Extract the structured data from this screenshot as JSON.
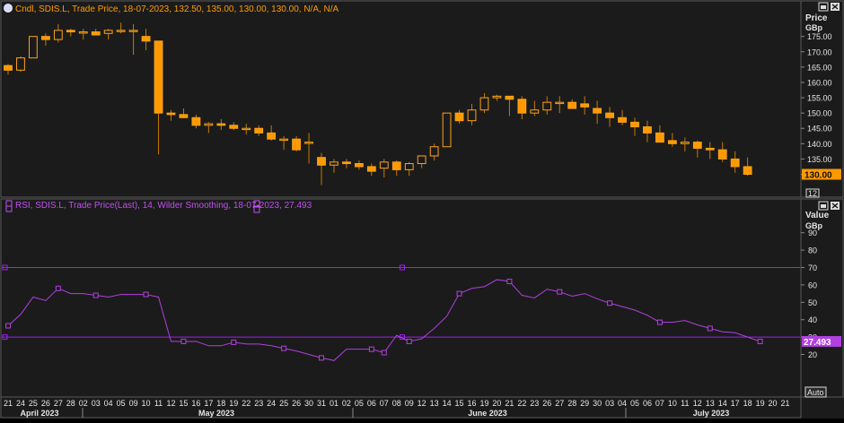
{
  "colors": {
    "background": "#1b1b1b",
    "panel_border": "#5a5a5a",
    "candle_fill": "#ff9900",
    "candle_outline": "#ffa31a",
    "wick": "#c97a00",
    "rsi_line": "#b040e0",
    "level_line": "#a020f0",
    "text": "#e6e6e6",
    "legend_price": "#ff9d00",
    "legend_rsi": "#c050f0",
    "price_tag_bg": "#ff9900",
    "rsi_tag_bg": "#b040e0"
  },
  "icons": {
    "restore": "restore-window-icon",
    "close": "close-icon",
    "legend": "legend-marker-icon"
  },
  "price_panel": {
    "legend": "Cndl, SDIS.L, Trade Price, 18-07-2023, 132.50, 135.00, 130.00, 130.00, N/A, N/A",
    "axis_title": "Price",
    "axis_unit": "GBp",
    "last_price_label": "130.00",
    "interval_badge": "12"
  },
  "rsi_panel": {
    "legend": "RSI, SDIS.L, Trade Price(Last), 14, Wilder Smoothing, 18-07-2023, 27.493",
    "axis_title": "Value",
    "axis_unit": "GBp",
    "last_value_label": "27.493",
    "auto_button": "Auto"
  },
  "chart_data": [
    {
      "type": "candlestick",
      "title": "",
      "ylabel": "Price",
      "yunit": "GBp",
      "ylim": [
        125,
        180
      ],
      "yticks": [
        130,
        135,
        140,
        145,
        150,
        155,
        160,
        165,
        170,
        175
      ],
      "x": [
        "2023-04-21",
        "2023-04-24",
        "2023-04-25",
        "2023-04-26",
        "2023-04-27",
        "2023-04-28",
        "2023-05-02",
        "2023-05-03",
        "2023-05-04",
        "2023-05-05",
        "2023-05-09",
        "2023-05-10",
        "2023-05-11",
        "2023-05-12",
        "2023-05-15",
        "2023-05-16",
        "2023-05-17",
        "2023-05-18",
        "2023-05-19",
        "2023-05-22",
        "2023-05-23",
        "2023-05-24",
        "2023-05-25",
        "2023-05-26",
        "2023-05-30",
        "2023-05-31",
        "2023-06-01",
        "2023-06-02",
        "2023-06-05",
        "2023-06-06",
        "2023-06-07",
        "2023-06-08",
        "2023-06-09",
        "2023-06-12",
        "2023-06-13",
        "2023-06-14",
        "2023-06-15",
        "2023-06-16",
        "2023-06-19",
        "2023-06-20",
        "2023-06-21",
        "2023-06-22",
        "2023-06-23",
        "2023-06-26",
        "2023-06-27",
        "2023-06-28",
        "2023-06-29",
        "2023-06-30",
        "2023-07-03",
        "2023-07-04",
        "2023-07-05",
        "2023-07-06",
        "2023-07-07",
        "2023-07-10",
        "2023-07-11",
        "2023-07-12",
        "2023-07-13",
        "2023-07-14",
        "2023-07-17",
        "2023-07-18"
      ],
      "open": [
        165.5,
        164.0,
        168.0,
        175.0,
        174.0,
        177.0,
        176.5,
        176.5,
        176.0,
        177.0,
        177.0,
        175.0,
        173.5,
        150.0,
        149.5,
        148.5,
        146.0,
        146.5,
        146.0,
        145.0,
        145.0,
        143.5,
        141.5,
        141.5,
        140.5,
        135.5,
        133.0,
        134.0,
        133.5,
        132.5,
        132.0,
        134.0,
        131.5,
        133.5,
        136.0,
        139.0,
        150.0,
        147.5,
        151.0,
        155.0,
        155.5,
        154.5,
        150.0,
        151.0,
        153.5,
        153.5,
        153.0,
        151.5,
        150.0,
        148.5,
        147.0,
        145.5,
        143.5,
        141.0,
        140.0,
        140.5,
        138.5,
        138.0,
        135.0,
        132.5
      ],
      "high": [
        166.0,
        168.5,
        175.0,
        176.0,
        179.0,
        177.5,
        177.5,
        177.5,
        177.5,
        179.5,
        179.0,
        177.5,
        173.5,
        151.0,
        151.5,
        149.5,
        147.0,
        148.0,
        147.0,
        146.5,
        146.0,
        146.0,
        142.5,
        142.5,
        143.5,
        137.0,
        135.0,
        135.0,
        134.5,
        133.5,
        135.0,
        134.5,
        134.0,
        136.0,
        140.0,
        150.0,
        151.0,
        153.0,
        156.5,
        156.0,
        155.5,
        155.5,
        154.0,
        155.5,
        155.5,
        154.5,
        155.5,
        154.0,
        152.0,
        151.0,
        148.5,
        147.5,
        146.0,
        143.5,
        142.0,
        141.0,
        140.5,
        140.5,
        137.5,
        135.5
      ],
      "low": [
        162.5,
        163.5,
        168.0,
        172.0,
        173.0,
        175.0,
        174.0,
        175.5,
        174.0,
        176.0,
        169.0,
        170.5,
        136.5,
        147.5,
        149.0,
        145.0,
        143.5,
        144.5,
        144.5,
        143.0,
        142.5,
        141.0,
        138.0,
        137.5,
        133.5,
        126.5,
        130.5,
        132.0,
        131.5,
        129.5,
        129.0,
        129.5,
        129.5,
        132.0,
        134.5,
        139.0,
        146.5,
        146.0,
        150.0,
        154.0,
        149.0,
        148.0,
        149.0,
        149.5,
        150.0,
        151.5,
        149.5,
        146.5,
        145.5,
        146.0,
        142.5,
        140.5,
        140.5,
        139.0,
        137.5,
        135.5,
        135.0,
        134.0,
        130.5,
        129.5
      ],
      "close": [
        164.0,
        168.0,
        175.0,
        174.0,
        177.0,
        176.5,
        176.5,
        175.5,
        177.0,
        177.0,
        177.0,
        173.5,
        150.0,
        149.5,
        148.5,
        146.0,
        146.5,
        146.0,
        145.0,
        145.0,
        143.5,
        141.5,
        141.5,
        138.0,
        140.5,
        133.0,
        134.0,
        133.5,
        132.5,
        131.0,
        134.0,
        131.5,
        133.5,
        136.0,
        139.0,
        150.0,
        147.5,
        151.0,
        155.0,
        155.5,
        154.5,
        150.0,
        151.0,
        153.5,
        153.5,
        151.5,
        152.0,
        150.0,
        148.5,
        147.0,
        145.5,
        143.5,
        140.5,
        140.0,
        140.5,
        138.5,
        138.0,
        135.0,
        132.5,
        130.0
      ]
    },
    {
      "type": "line",
      "title": "",
      "ylabel": "Value",
      "yunit": "GBp",
      "ylim": [
        10,
        95
      ],
      "yticks": [
        20,
        30,
        40,
        50,
        60,
        70,
        80,
        90
      ],
      "levels": [
        70,
        30
      ],
      "series": [
        {
          "values": [
            36.5,
            43.0,
            53.0,
            51.0,
            58.0,
            55.0,
            55.0,
            54.0,
            53.0,
            54.5,
            54.5,
            54.5,
            53.0,
            27.5,
            27.5,
            27.5,
            25.0,
            25.0,
            27.0,
            26.0,
            26.0,
            25.0,
            23.5,
            22.0,
            20.0,
            18.0,
            16.5,
            23.0,
            23.0,
            23.0,
            21.0,
            31.0,
            27.5,
            29.0,
            35.0,
            42.0,
            55.0,
            58.0,
            59.0,
            63.0,
            62.0,
            54.0,
            52.5,
            57.5,
            56.0,
            53.5,
            55.0,
            52.0,
            49.5,
            47.5,
            45.5,
            42.5,
            38.5,
            38.5,
            39.5,
            37.0,
            35.0,
            33.0,
            32.5,
            30.0,
            27.49
          ],
          "markers_at": [
            0,
            4,
            7,
            11,
            14,
            18,
            22,
            25,
            29,
            30,
            32,
            36,
            40,
            44,
            48,
            52,
            56,
            60
          ]
        }
      ]
    },
    {
      "type": "date-axis",
      "day_ticks": [
        "21",
        "24",
        "25",
        "26",
        "27",
        "28",
        "02",
        "03",
        "04",
        "05",
        "09",
        "10",
        "11",
        "12",
        "15",
        "16",
        "17",
        "18",
        "19",
        "22",
        "23",
        "24",
        "25",
        "26",
        "30",
        "31",
        "01",
        "02",
        "05",
        "06",
        "07",
        "08",
        "09",
        "12",
        "13",
        "14",
        "15",
        "16",
        "19",
        "20",
        "21",
        "22",
        "23",
        "26",
        "27",
        "28",
        "29",
        "30",
        "03",
        "04",
        "05",
        "06",
        "07",
        "10",
        "11",
        "12",
        "13",
        "14",
        "17",
        "18",
        "19",
        "20",
        "21"
      ],
      "months": [
        "April 2023",
        "May 2023",
        "June 2023",
        "July 2023"
      ]
    }
  ]
}
